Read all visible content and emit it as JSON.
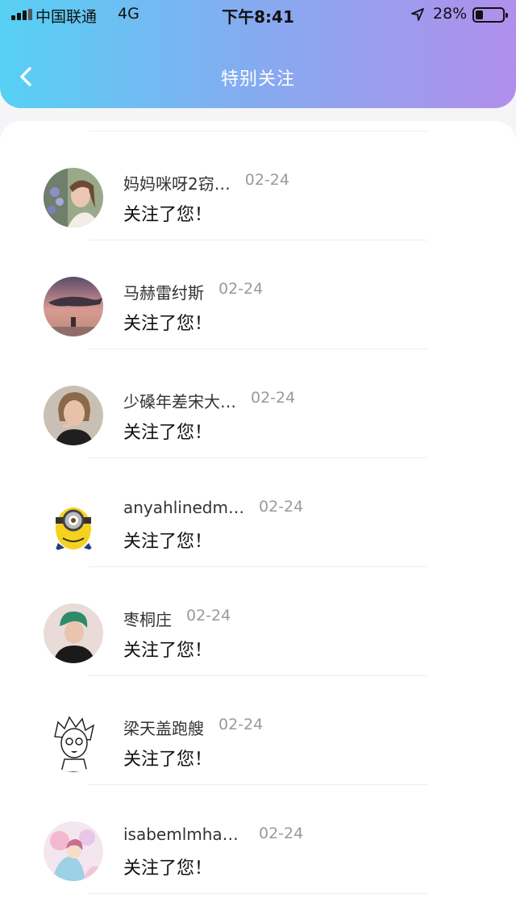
{
  "status_bar": {
    "carrier": "中国联通",
    "network": "4G",
    "time": "下午8:41",
    "battery": "28%",
    "battery_level": 0.28,
    "signal_icon": "signal-bars-icon",
    "location_icon": "location-arrow-icon",
    "battery_icon": "battery-icon"
  },
  "header": {
    "title": "特别关注",
    "back_icon": "chevron-left-icon",
    "gradient": [
      "#56d1f4",
      "#b08fec"
    ]
  },
  "notifications": [
    {
      "name": "妈妈咪呀2窃…",
      "date": "02-24",
      "message": "关注了您！",
      "avatar": "woman-with-flowers"
    },
    {
      "name": "马赫雷纣斯",
      "date": "02-24",
      "message": "关注了您！",
      "avatar": "whale-sunset"
    },
    {
      "name": "少磉年差宋大…",
      "date": "02-24",
      "message": "关注了您！",
      "avatar": "person-portrait"
    },
    {
      "name": "anyahlinedmar…",
      "date": "02-24",
      "message": "关注了您！",
      "avatar": "minion-cartoon"
    },
    {
      "name": "枣桐庄",
      "date": "02-24",
      "message": "关注了您！",
      "avatar": "green-hair-boy"
    },
    {
      "name": "梁天盖跑艘",
      "date": "02-24",
      "message": "关注了您！",
      "avatar": "manga-sketch"
    },
    {
      "name": "isabemlmhara…",
      "date": "02-24",
      "message": "关注了您！",
      "avatar": "pastel-illustration"
    }
  ]
}
